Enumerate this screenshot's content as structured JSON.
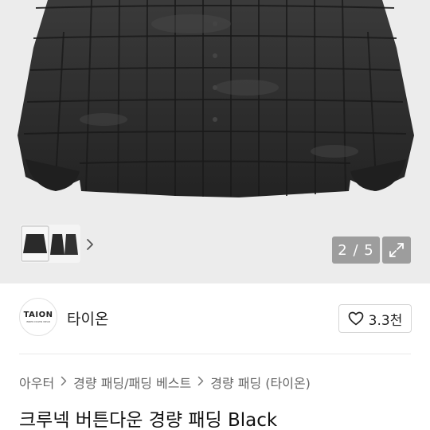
{
  "gallery": {
    "current_page": "2",
    "total_pages": "5",
    "counter_text": "2 / 5"
  },
  "icons": {
    "thumb_next": "chevron-right-icon",
    "expand": "expand-arrows-icon",
    "like": "heart-outline-icon",
    "breadcrumb_separator": "chevron-right-icon"
  },
  "shop": {
    "logo_text": "TAION",
    "logo_subtext": "INNER DOWN WEAR",
    "name": "타이온",
    "likes": "3.3천"
  },
  "breadcrumb": [
    {
      "label": "아우터"
    },
    {
      "label": "경량 패딩/패딩 베스트"
    },
    {
      "label": "경량 패딩 (타이온)"
    }
  ],
  "product": {
    "title": "크루넥 버튼다운 경량 패딩 Black"
  },
  "colors": {
    "image_background": "#ececec",
    "jacket": "#2b2b2b",
    "overlay_button": "#9d9d9d"
  }
}
